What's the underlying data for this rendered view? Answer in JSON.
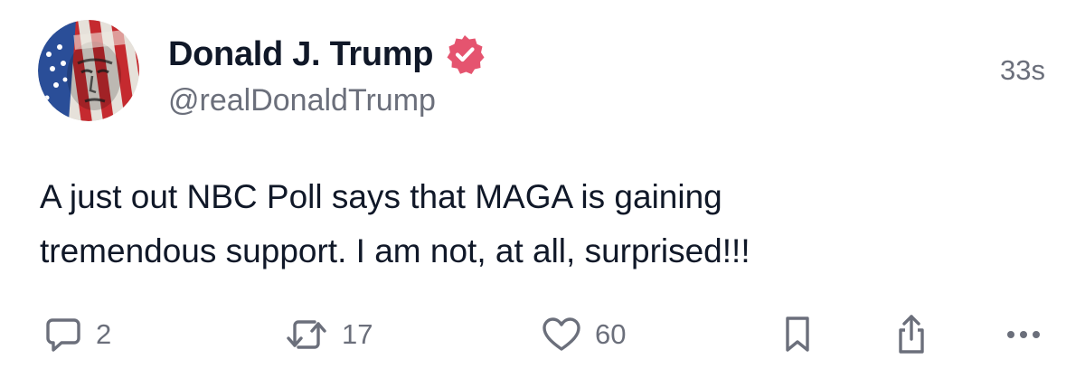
{
  "post": {
    "author": {
      "display_name": "Donald J. Trump",
      "handle": "@realDonaldTrump",
      "verified": true
    },
    "timestamp": "33s",
    "text": "A just out NBC Poll says that MAGA is gaining\ntremendous support. I am not, at all, surprised!!!",
    "actions": {
      "replies": "2",
      "reposts": "17",
      "likes": "60"
    }
  },
  "icons": {
    "verified": "verified-badge-icon",
    "reply": "speech-bubble-icon",
    "repost": "repost-arrows-icon",
    "like": "heart-icon",
    "bookmark": "bookmark-icon",
    "share": "share-upload-icon",
    "more": "more-dots-icon"
  },
  "colors": {
    "verified_badge": "#e5546f",
    "text_primary": "#101828",
    "text_secondary": "#6b6f7b"
  }
}
